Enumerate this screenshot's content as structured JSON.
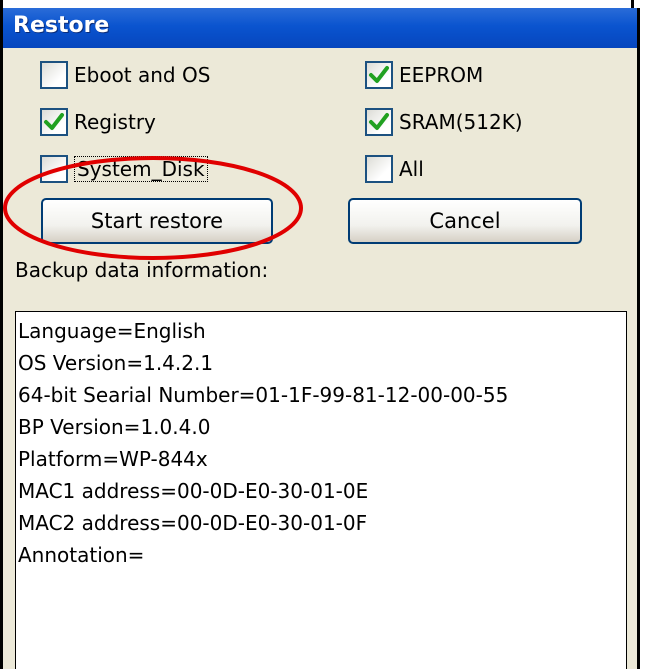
{
  "window": {
    "title": "Restore"
  },
  "options": {
    "eboot_os": {
      "label": "Eboot and OS",
      "checked": false
    },
    "eeprom": {
      "label": "EEPROM",
      "checked": true
    },
    "registry": {
      "label": "Registry",
      "checked": true
    },
    "sram": {
      "label": "SRAM(512K)",
      "checked": true
    },
    "system_disk": {
      "label": "System_Disk",
      "checked": false
    },
    "all": {
      "label": "All",
      "checked": false
    }
  },
  "buttons": {
    "start_restore": "Start restore",
    "cancel": "Cancel"
  },
  "info": {
    "label": "Backup data information:",
    "lines": [
      "Language=English",
      "OS Version=1.4.2.1",
      "64-bit Searial Number=01-1F-99-81-12-00-00-55",
      "BP Version=1.0.4.0",
      "Platform=WP-844x",
      "MAC1 address=00-0D-E0-30-01-0E",
      "MAC2 address=00-0D-E0-30-01-0F",
      "Annotation="
    ]
  },
  "colors": {
    "titlebar": "#0a54cf",
    "window_bg": "#ece9d8",
    "check": "#21a121",
    "annotation_ellipse": "#e00000"
  }
}
